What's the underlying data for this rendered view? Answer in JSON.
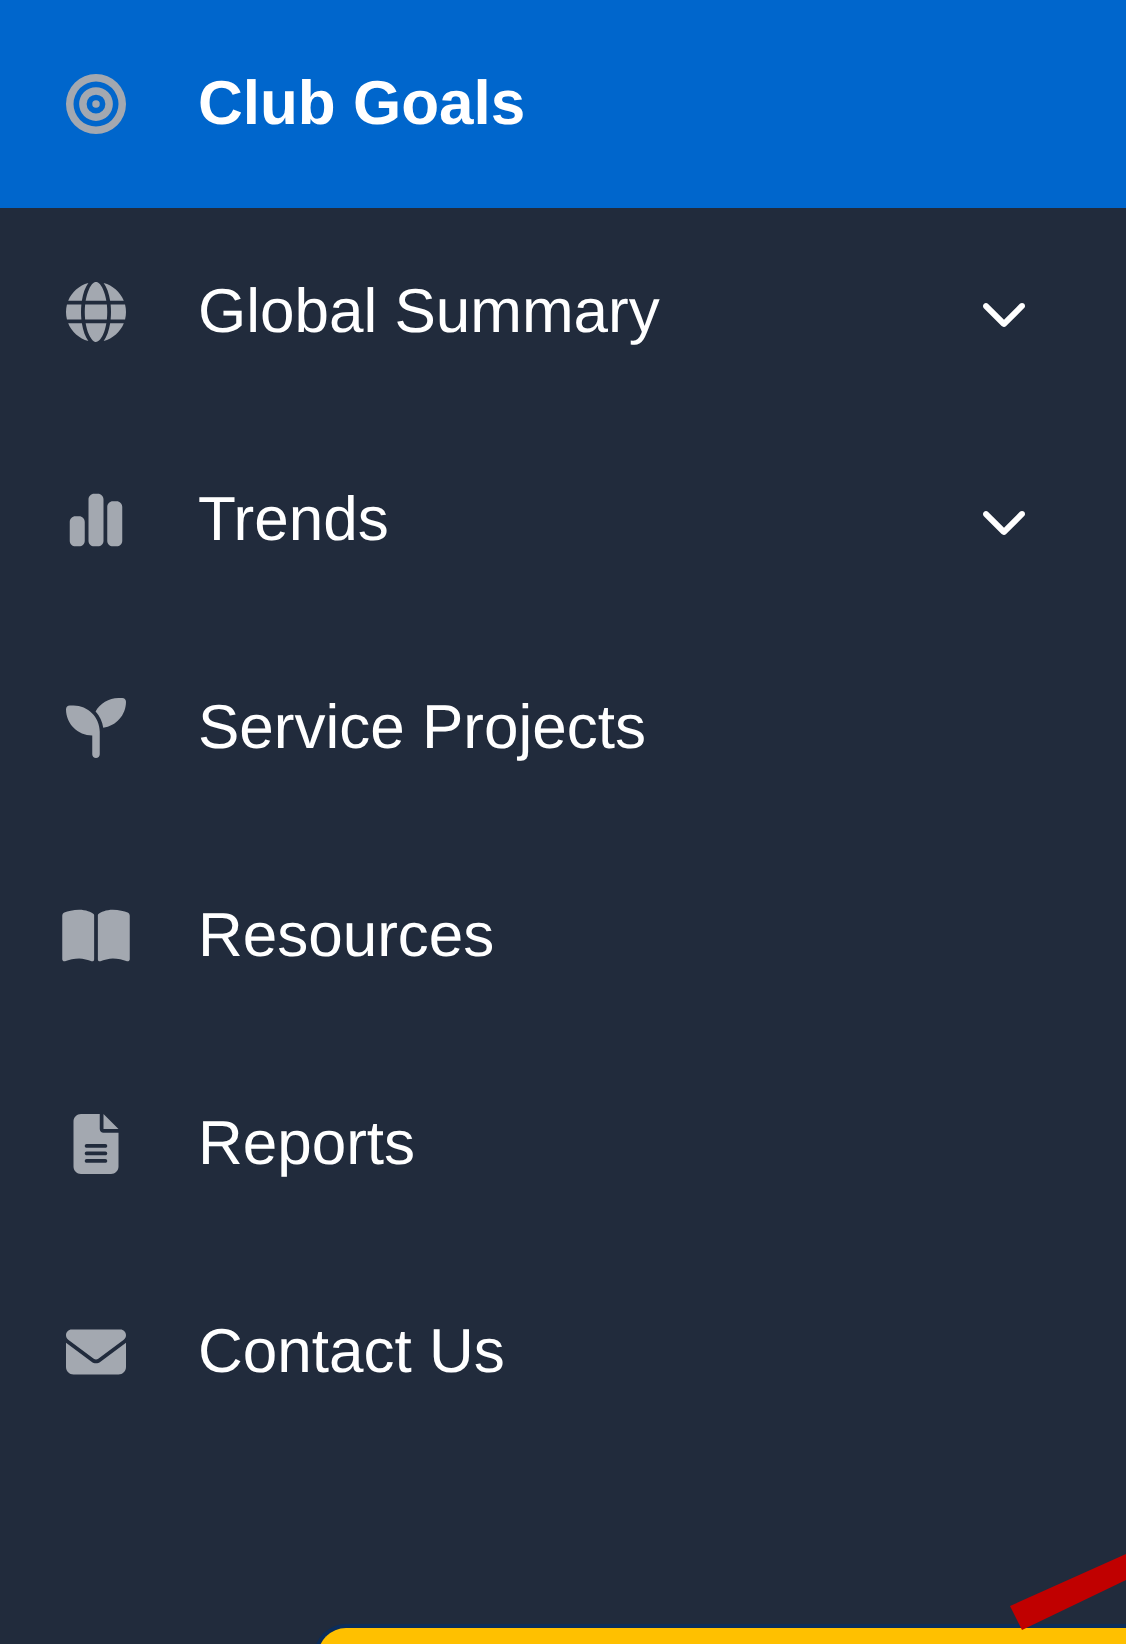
{
  "sidebar": {
    "items": [
      {
        "kind": "goals",
        "label": "Club Goals",
        "selected": true,
        "expandable": false
      },
      {
        "kind": "globe",
        "label": "Global Summary",
        "selected": false,
        "expandable": true
      },
      {
        "kind": "chart",
        "label": "Trends",
        "selected": false,
        "expandable": true
      },
      {
        "kind": "plant",
        "label": "Service Projects",
        "selected": false,
        "expandable": false
      },
      {
        "kind": "book",
        "label": "Resources",
        "selected": false,
        "expandable": false
      },
      {
        "kind": "report",
        "label": "Reports",
        "selected": false,
        "expandable": false
      },
      {
        "kind": "mail",
        "label": "Contact Us",
        "selected": false,
        "expandable": false
      }
    ]
  }
}
